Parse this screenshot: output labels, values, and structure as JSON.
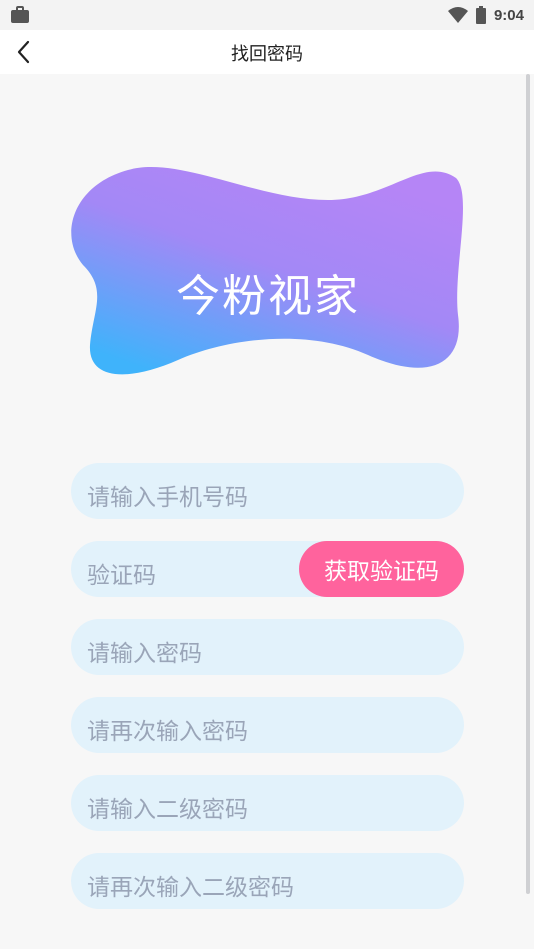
{
  "status_bar": {
    "time": "9:04",
    "left_icon": "briefcase-icon",
    "wifi_icon": "wifi-icon",
    "battery_icon": "battery-icon"
  },
  "header": {
    "title": "找回密码",
    "back_icon": "back-arrow-icon"
  },
  "logo": {
    "text": "今粉视家",
    "gradient_top": "#b585f6",
    "gradient_bottom": "#3fb3fb"
  },
  "form": {
    "phone_placeholder": "请输入手机号码",
    "code_placeholder": "验证码",
    "get_code_label": "获取验证码",
    "password_placeholder": "请输入密码",
    "password_confirm_placeholder": "请再次输入密码",
    "secondary_password_placeholder": "请输入二级密码",
    "secondary_password_confirm_placeholder": "请再次输入二级密码"
  },
  "colors": {
    "field_bg": "#e2f2fb",
    "button_bg": "#ff639d",
    "placeholder": "#9aa5b8"
  }
}
